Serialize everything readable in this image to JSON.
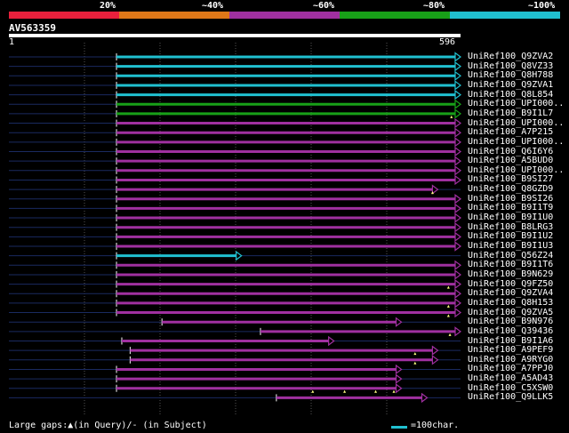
{
  "legend": {
    "labels": [
      "20%",
      "~40%",
      "~60%",
      "~80%",
      "~100%"
    ],
    "colors": [
      "#e8203c",
      "#e07818",
      "#a030a0",
      "#18a018",
      "#20c0d0"
    ]
  },
  "query": {
    "id": "AV563359",
    "start": "1",
    "end": "596",
    "length": 596
  },
  "hits": [
    {
      "name": "UniRef100_Q9ZVA2",
      "start": 142,
      "end": 596,
      "color": "#20c0d0",
      "marks": []
    },
    {
      "name": "UniRef100_Q8VZ33",
      "start": 142,
      "end": 596,
      "color": "#20c0d0",
      "marks": []
    },
    {
      "name": "UniRef100_Q8H788",
      "start": 142,
      "end": 596,
      "color": "#20c0d0",
      "marks": []
    },
    {
      "name": "UniRef100_Q9ZVA1",
      "start": 142,
      "end": 596,
      "color": "#20c0d0",
      "marks": []
    },
    {
      "name": "UniRef100_Q8L854",
      "start": 142,
      "end": 596,
      "color": "#20c0d0",
      "marks": []
    },
    {
      "name": "UniRef100_UPI000..",
      "start": 142,
      "end": 596,
      "color": "#18a018",
      "marks": []
    },
    {
      "name": "UniRef100_B9I1L7",
      "start": 142,
      "end": 596,
      "color": "#18a018",
      "marks": [
        584
      ]
    },
    {
      "name": "UniRef100_UPI000..",
      "start": 142,
      "end": 596,
      "color": "#a030a0",
      "marks": []
    },
    {
      "name": "UniRef100_A7P215",
      "start": 142,
      "end": 596,
      "color": "#a030a0",
      "marks": []
    },
    {
      "name": "UniRef100_UPI000..",
      "start": 142,
      "end": 596,
      "color": "#a030a0",
      "marks": []
    },
    {
      "name": "UniRef100_Q6I6Y6",
      "start": 142,
      "end": 596,
      "color": "#a030a0",
      "marks": []
    },
    {
      "name": "UniRef100_A5BUD0",
      "start": 142,
      "end": 596,
      "color": "#a030a0",
      "marks": []
    },
    {
      "name": "UniRef100_UPI000..",
      "start": 142,
      "end": 596,
      "color": "#a030a0",
      "marks": []
    },
    {
      "name": "UniRef100_B9SI27",
      "start": 142,
      "end": 596,
      "color": "#a030a0",
      "marks": []
    },
    {
      "name": "UniRef100_Q8GZD9",
      "start": 142,
      "end": 566,
      "color": "#a030a0",
      "marks": [
        559
      ]
    },
    {
      "name": "UniRef100_B9SI26",
      "start": 142,
      "end": 596,
      "color": "#a030a0",
      "marks": []
    },
    {
      "name": "UniRef100_B9I1T9",
      "start": 142,
      "end": 596,
      "color": "#a030a0",
      "marks": []
    },
    {
      "name": "UniRef100_B9I1U0",
      "start": 142,
      "end": 596,
      "color": "#a030a0",
      "marks": []
    },
    {
      "name": "UniRef100_B8LRG3",
      "start": 142,
      "end": 596,
      "color": "#a030a0",
      "marks": []
    },
    {
      "name": "UniRef100_B9I1U2",
      "start": 142,
      "end": 596,
      "color": "#a030a0",
      "marks": []
    },
    {
      "name": "UniRef100_B9I1U3",
      "start": 142,
      "end": 596,
      "color": "#a030a0",
      "marks": []
    },
    {
      "name": "UniRef100_Q56Z24",
      "start": 142,
      "end": 307,
      "color": "#20c0d0",
      "marks": []
    },
    {
      "name": "UniRef100_B9I1T6",
      "start": 142,
      "end": 596,
      "color": "#a030a0",
      "marks": []
    },
    {
      "name": "UniRef100_B9N629",
      "start": 142,
      "end": 596,
      "color": "#a030a0",
      "marks": []
    },
    {
      "name": "UniRef100_Q9FZ50",
      "start": 142,
      "end": 596,
      "color": "#a030a0",
      "marks": [
        580
      ]
    },
    {
      "name": "UniRef100_Q9ZVA4",
      "start": 142,
      "end": 596,
      "color": "#a030a0",
      "marks": []
    },
    {
      "name": "UniRef100_Q8H153",
      "start": 142,
      "end": 596,
      "color": "#a030a0",
      "marks": [
        580
      ]
    },
    {
      "name": "UniRef100_Q9ZVA5",
      "start": 142,
      "end": 596,
      "color": "#a030a0",
      "marks": [
        580
      ]
    },
    {
      "name": "UniRef100_B9N976",
      "start": 202,
      "end": 518,
      "color": "#a030a0",
      "marks": []
    },
    {
      "name": "UniRef100_Q39436",
      "start": 332,
      "end": 596,
      "color": "#a030a0",
      "marks": [
        582
      ]
    },
    {
      "name": "UniRef100_B9I1A6",
      "start": 149,
      "end": 429,
      "color": "#a030a0",
      "marks": []
    },
    {
      "name": "UniRef100_A9PEF9",
      "start": 160,
      "end": 566,
      "color": "#a030a0",
      "marks": [
        536
      ]
    },
    {
      "name": "UniRef100_A9RYG0",
      "start": 160,
      "end": 566,
      "color": "#a030a0",
      "marks": [
        536
      ]
    },
    {
      "name": "UniRef100_A7PPJ0",
      "start": 142,
      "end": 518,
      "color": "#a030a0",
      "marks": []
    },
    {
      "name": "UniRef100_A5AD43",
      "start": 142,
      "end": 518,
      "color": "#a030a0",
      "marks": []
    },
    {
      "name": "UniRef100_C5XSW0",
      "start": 142,
      "end": 518,
      "color": "#a030a0",
      "marks": [
        401,
        443,
        484,
        508
      ]
    },
    {
      "name": "UniRef100_Q9LLK5",
      "start": 353,
      "end": 552,
      "color": "#a030a0",
      "marks": []
    }
  ],
  "footer": {
    "gaps_text": "Large gaps:▲(in Query)/- (in Subject)",
    "scale_text": "=100char."
  }
}
